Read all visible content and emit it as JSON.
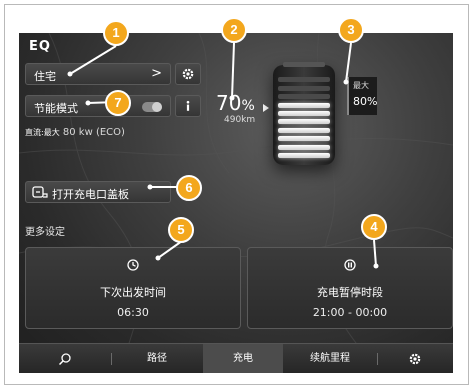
{
  "app": {
    "logo": "EQ"
  },
  "controls": {
    "home_label": "住宅",
    "home_chevron": ">",
    "eco_label": "节能模式",
    "eco_toggle_state": "on",
    "flap_label": "打开充电口盖板"
  },
  "eco_info": {
    "prefix": "直流:最大",
    "value": "80 kw (ECO)"
  },
  "battery": {
    "soc_number": "70",
    "soc_unit": "%",
    "range": "490km",
    "charged_cells": 7,
    "total_cells": 10
  },
  "max_limit": {
    "label": "最大",
    "value": "80%"
  },
  "more_settings": {
    "title": "更多设定"
  },
  "cards": {
    "departure": {
      "title": "下次出发时间",
      "value": "06:30",
      "icon": "clock-icon"
    },
    "pause": {
      "title": "充电暂停时段",
      "value": "21:00 - 00:00",
      "icon": "pause-icon"
    }
  },
  "nav": {
    "search_icon": "search-icon",
    "route": "路径",
    "charge": "充电",
    "range": "续航里程",
    "settings_icon": "gear-icon"
  },
  "callouts": [
    "1",
    "2",
    "3",
    "4",
    "5",
    "6",
    "7"
  ],
  "colors": {
    "accent": "#f3a71d",
    "screen_bg": "#2f2f2f",
    "text": "#ffffff"
  }
}
